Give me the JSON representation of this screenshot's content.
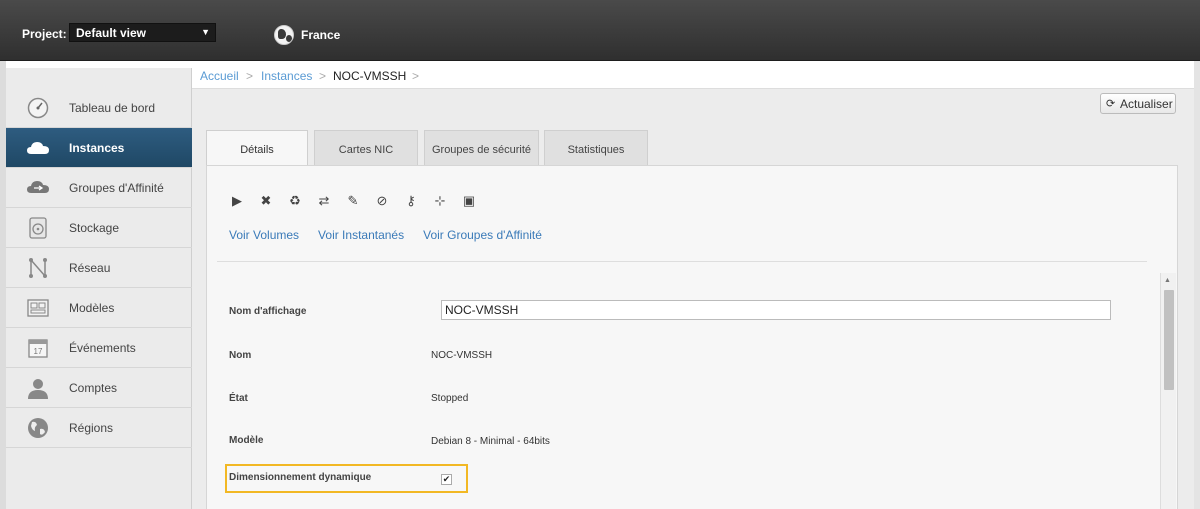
{
  "header": {
    "project_label": "Project:",
    "project_value": "Default view",
    "zone_label": "France"
  },
  "sidebar": {
    "items": [
      {
        "label": "Tableau de bord",
        "icon": "dashboard-icon"
      },
      {
        "label": "Instances",
        "icon": "cloud-icon",
        "active": true
      },
      {
        "label": "Groupes d'Affinité",
        "icon": "affinity-icon"
      },
      {
        "label": "Stockage",
        "icon": "storage-icon"
      },
      {
        "label": "Réseau",
        "icon": "network-icon"
      },
      {
        "label": "Modèles",
        "icon": "templates-icon"
      },
      {
        "label": "Événements",
        "icon": "calendar-icon"
      },
      {
        "label": "Comptes",
        "icon": "user-icon"
      },
      {
        "label": "Régions",
        "icon": "globe-icon"
      }
    ]
  },
  "breadcrumb": {
    "home": "Accueil",
    "sep": ">",
    "section": "Instances",
    "current": "NOC-VMSSH"
  },
  "toolbar": {
    "refresh_label": "Actualiser"
  },
  "tabs": [
    {
      "label": "Détails",
      "active": true
    },
    {
      "label": "Cartes NIC"
    },
    {
      "label": "Groupes de sécurité"
    },
    {
      "label": "Statistiques"
    }
  ],
  "actions": [
    "start-icon",
    "destroy-icon",
    "recycle-icon",
    "migrate-icon",
    "edit-icon",
    "attach-iso-icon",
    "reset-password-icon",
    "scale-icon",
    "console-icon"
  ],
  "links": {
    "volumes": "Voir Volumes",
    "snapshots": "Voir Instantanés",
    "affinity": "Voir Groupes d'Affinité"
  },
  "details": {
    "display_name_label": "Nom d'affichage",
    "display_name_value": "NOC-VMSSH",
    "name_label": "Nom",
    "name_value": "NOC-VMSSH",
    "state_label": "État",
    "state_value": "Stopped",
    "template_label": "Modèle",
    "template_value": "Debian 8 - Minimal - 64bits",
    "dynamic_scaling_label": "Dimensionnement dynamique",
    "dynamic_scaling_checked": true
  },
  "colors": {
    "highlight": "#f2b824",
    "link": "#3a7ab8",
    "active_nav": "#1f4865"
  }
}
